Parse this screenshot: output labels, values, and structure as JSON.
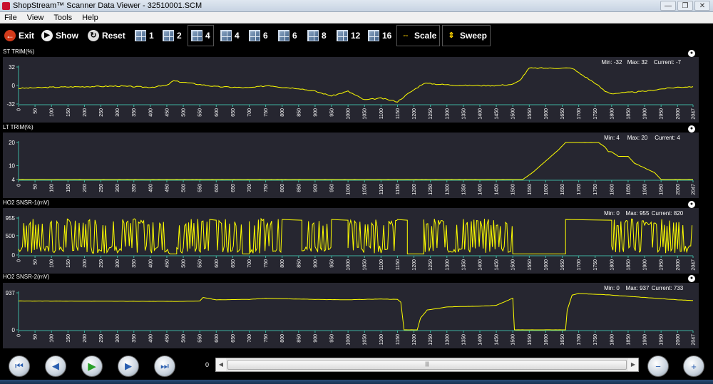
{
  "window": {
    "title": "ShopStream™ Scanner Data Viewer - 32510001.SCM",
    "minimize": "—",
    "restore": "❐",
    "close": "✕"
  },
  "menu": [
    "File",
    "View",
    "Tools",
    "Help"
  ],
  "toolbar": {
    "exit": "Exit",
    "show": "Show",
    "reset": "Reset",
    "layouts": [
      "1",
      "2",
      "4",
      "4",
      "6",
      "6",
      "8",
      "12",
      "16"
    ],
    "scale": "Scale",
    "sweep": "Sweep"
  },
  "xticks": [
    "0",
    "50",
    "100",
    "150",
    "200",
    "250",
    "300",
    "350",
    "400",
    "450",
    "500",
    "550",
    "600",
    "650",
    "700",
    "750",
    "800",
    "850",
    "900",
    "950",
    "1000",
    "1050",
    "1100",
    "1150",
    "1200",
    "1250",
    "1300",
    "1350",
    "1400",
    "1450",
    "1500",
    "1550",
    "1600",
    "1650",
    "1700",
    "1750",
    "1800",
    "1850",
    "1900",
    "1950",
    "2000",
    "2047"
  ],
  "colors": {
    "trace": "#ffff00",
    "panel_bg": "#262630",
    "axis": "#3fb3a0",
    "text": "#ffffff"
  },
  "chart_data": [
    {
      "type": "line",
      "title": "ST TRIM(%)",
      "ylim": [
        -32,
        32
      ],
      "yticks": [
        "32",
        "0",
        "-32"
      ],
      "min": "Min: -32",
      "max": "Max: 32",
      "current": "Current: -7",
      "x": [
        0,
        100,
        200,
        300,
        400,
        450,
        470,
        520,
        600,
        650,
        700,
        760,
        800,
        850,
        900,
        950,
        1000,
        1050,
        1100,
        1150,
        1180,
        1230,
        1280,
        1350,
        1400,
        1450,
        1500,
        1520,
        1550,
        1600,
        1650,
        1680,
        1700,
        1750,
        1780,
        1800,
        1850,
        1900,
        1950,
        2000,
        2047
      ],
      "y": [
        -5,
        -3,
        -2,
        -1,
        -3,
        0,
        8,
        4,
        -2,
        -3,
        -4,
        0,
        -3,
        -5,
        -10,
        -18,
        -10,
        -25,
        -22,
        -28,
        -15,
        4,
        2,
        0,
        0,
        0,
        2,
        8,
        30,
        30,
        30,
        30,
        22,
        4,
        -10,
        -14,
        -12,
        -10,
        -6,
        -3,
        -2
      ]
    },
    {
      "type": "line",
      "title": "LT TRIM(%)",
      "ylim": [
        4,
        20
      ],
      "yticks": [
        "20",
        "10",
        "4"
      ],
      "min": "Min: 4",
      "max": "Max: 20",
      "current": "Current: 4",
      "x": [
        0,
        1500,
        1530,
        1560,
        1600,
        1640,
        1660,
        1700,
        1750,
        1760,
        1780,
        1790,
        1800,
        1820,
        1850,
        1870,
        1900,
        1930,
        1950,
        2000,
        2047
      ],
      "y": [
        4,
        4,
        4,
        7,
        12,
        17,
        20,
        20,
        20,
        20,
        18,
        16,
        16,
        14,
        14,
        11,
        9,
        7,
        4,
        4,
        4
      ]
    },
    {
      "type": "line",
      "title": "HO2 SNSR-1(mV)",
      "ylim": [
        0,
        955
      ],
      "yticks": [
        "955",
        "500",
        "0"
      ],
      "min": "Min: 0",
      "max": "Max: 955",
      "current": "Current: 820",
      "segments": [
        {
          "from": 0,
          "to": 460,
          "kind": "osc"
        },
        {
          "from": 460,
          "to": 480,
          "kind": "low"
        },
        {
          "from": 480,
          "to": 580,
          "kind": "osc"
        },
        {
          "from": 580,
          "to": 600,
          "kind": "high"
        },
        {
          "from": 600,
          "to": 680,
          "kind": "osc"
        },
        {
          "from": 680,
          "to": 700,
          "kind": "low"
        },
        {
          "from": 700,
          "to": 800,
          "kind": "osc"
        },
        {
          "from": 800,
          "to": 860,
          "kind": "high"
        },
        {
          "from": 860,
          "to": 950,
          "kind": "osc"
        },
        {
          "from": 950,
          "to": 1000,
          "kind": "high"
        },
        {
          "from": 1000,
          "to": 1150,
          "kind": "osc"
        },
        {
          "from": 1150,
          "to": 1180,
          "kind": "high"
        },
        {
          "from": 1180,
          "to": 1230,
          "kind": "low"
        },
        {
          "from": 1230,
          "to": 1500,
          "kind": "osc"
        },
        {
          "from": 1500,
          "to": 1660,
          "kind": "low"
        },
        {
          "from": 1660,
          "to": 1800,
          "kind": "high"
        },
        {
          "from": 1800,
          "to": 2047,
          "kind": "osc"
        }
      ]
    },
    {
      "type": "line",
      "title": "HO2 SNSR-2(mV)",
      "ylim": [
        0,
        937
      ],
      "yticks": [
        "937",
        "0"
      ],
      "min": "Min: 0",
      "max": "Max: 937",
      "current": "Current: 733",
      "x": [
        0,
        500,
        550,
        560,
        600,
        700,
        750,
        800,
        900,
        1000,
        1100,
        1150,
        1160,
        1170,
        1210,
        1220,
        1240,
        1300,
        1400,
        1450,
        1500,
        1505,
        1660,
        1665,
        1680,
        1700,
        1800,
        1900,
        2000,
        2047
      ],
      "y": [
        730,
        720,
        730,
        820,
        760,
        770,
        800,
        790,
        770,
        760,
        780,
        770,
        700,
        0,
        0,
        300,
        500,
        580,
        600,
        620,
        800,
        0,
        0,
        500,
        880,
        920,
        880,
        820,
        760,
        740
      ]
    }
  ],
  "bottom": {
    "prev_all": "⏮",
    "prev": "◀",
    "play": "▶",
    "next": "▶",
    "next_all": "⏭",
    "position": "0",
    "thumb": "|||",
    "zoom_out": "−",
    "zoom_in": "+"
  }
}
